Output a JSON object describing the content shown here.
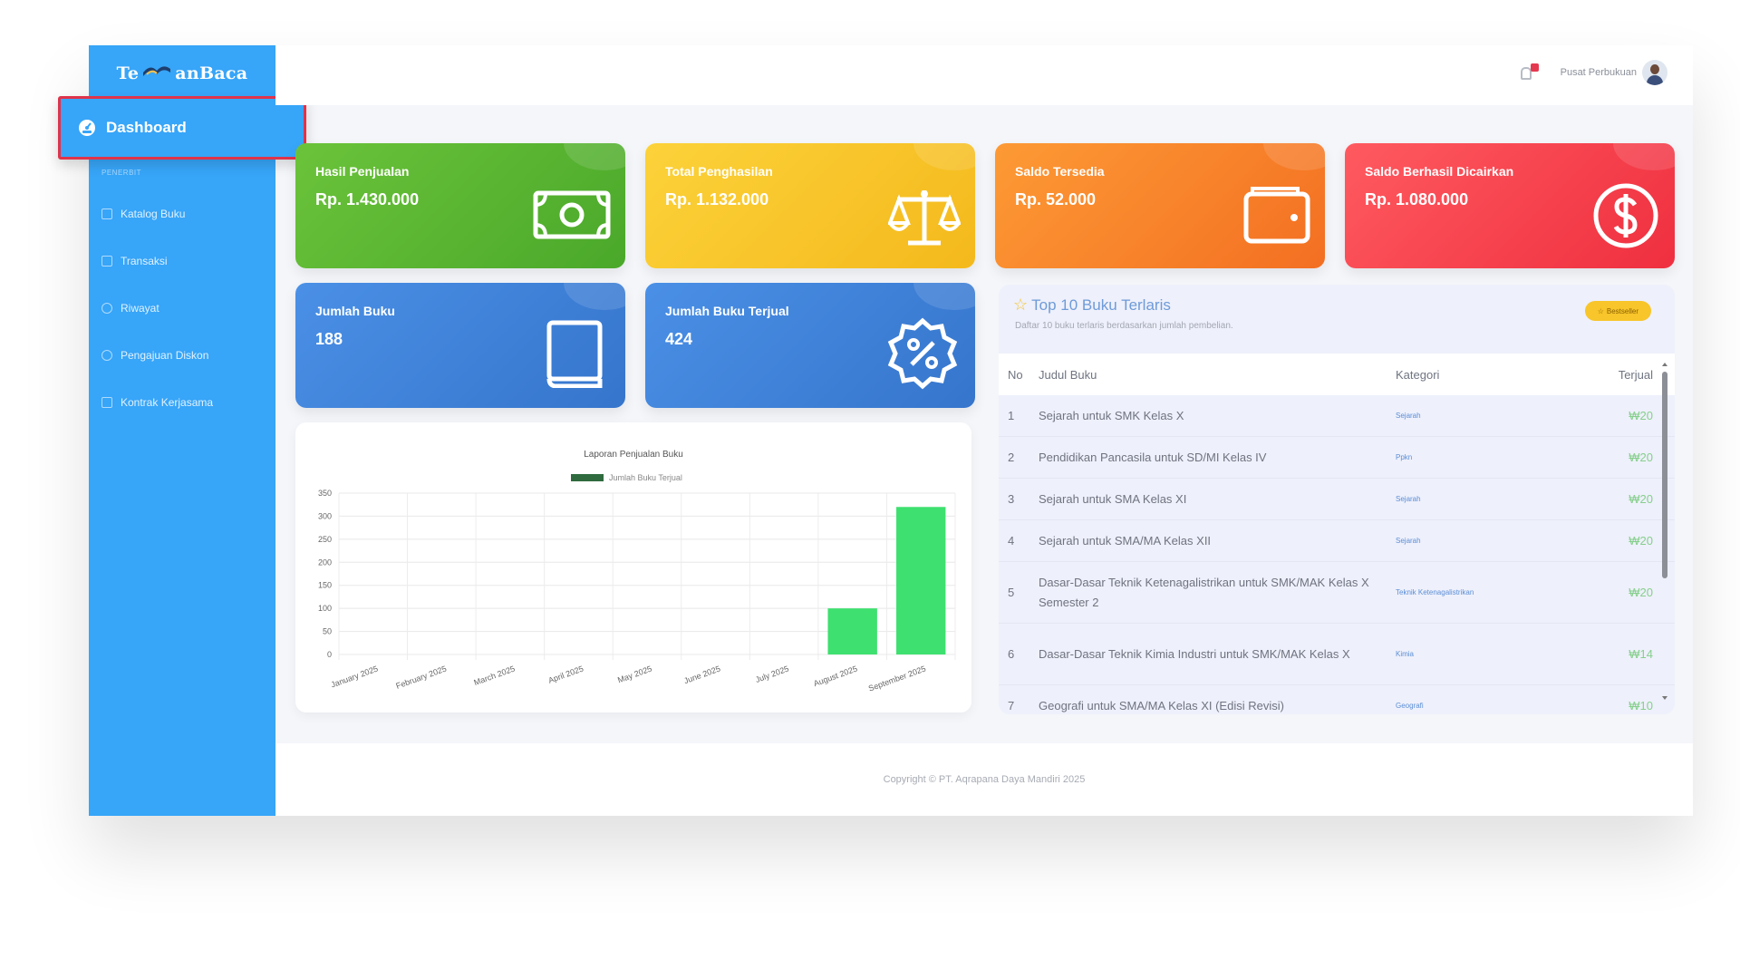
{
  "brand": {
    "left": "Te",
    "right": "anBaca"
  },
  "sidebar": {
    "active_item": "Dashboard",
    "section_label": "PENERBIT",
    "items": [
      {
        "label": "Katalog Buku",
        "icon": "book-icon"
      },
      {
        "label": "Transaksi",
        "icon": "cart-icon"
      },
      {
        "label": "Riwayat",
        "icon": "history-icon"
      },
      {
        "label": "Pengajuan Diskon",
        "icon": "percent-icon"
      },
      {
        "label": "Kontrak Kerjasama",
        "icon": "document-icon"
      }
    ]
  },
  "topbar": {
    "user_name": "Pusat Perbukuan"
  },
  "cards": {
    "hasil_penjualan": {
      "title": "Hasil Penjualan",
      "value": "Rp. 1.430.000",
      "icon": "money-icon"
    },
    "total_penghasilan": {
      "title": "Total Penghasilan",
      "value": "Rp. 1.132.000",
      "icon": "scale-icon"
    },
    "saldo_tersedia": {
      "title": "Saldo Tersedia",
      "value": "Rp. 52.000",
      "icon": "wallet-icon"
    },
    "saldo_dicairkan": {
      "title": "Saldo Berhasil Dicairkan",
      "value": "Rp. 1.080.000",
      "icon": "dollar-icon"
    },
    "jumlah_buku": {
      "title": "Jumlah Buku",
      "value": "188",
      "icon": "book-icon"
    },
    "jumlah_terjual": {
      "title": "Jumlah Buku Terjual",
      "value": "424",
      "icon": "discount-icon"
    }
  },
  "chart_data": {
    "type": "bar",
    "title": "Laporan Penjualan Buku",
    "categories": [
      "January 2025",
      "February 2025",
      "March 2025",
      "April 2025",
      "May 2025",
      "June 2025",
      "July 2025",
      "August 2025",
      "September 2025"
    ],
    "series": [
      {
        "name": "Jumlah Buku Terjual",
        "values": [
          0,
          0,
          0,
          0,
          0,
          0,
          0,
          100,
          320
        ]
      }
    ],
    "ylim": [
      0,
      350
    ],
    "yticks": [
      0,
      50,
      100,
      150,
      200,
      250,
      300,
      350
    ],
    "colors": {
      "bar": "#3ee06f",
      "legend": "#2f6b3e"
    },
    "grid": true,
    "legend": "top"
  },
  "top_books": {
    "title": "Top 10 Buku Terlaris",
    "subtitle": "Daftar 10 buku terlaris berdasarkan jumlah pembelian.",
    "badge": "Bestseller",
    "headers": {
      "no": "No",
      "title": "Judul Buku",
      "category": "Kategori",
      "sold": "Terjual"
    },
    "rows": [
      {
        "no": "1",
        "title": "Sejarah untuk SMK Kelas X",
        "category": "Sejarah",
        "sold": "20"
      },
      {
        "no": "2",
        "title": "Pendidikan Pancasila untuk SD/MI Kelas IV",
        "category": "Ppkn",
        "sold": "20"
      },
      {
        "no": "3",
        "title": "Sejarah untuk SMA Kelas XI",
        "category": "Sejarah",
        "sold": "20"
      },
      {
        "no": "4",
        "title": "Sejarah untuk SMA/MA Kelas XII",
        "category": "Sejarah",
        "sold": "20"
      },
      {
        "no": "5",
        "title": "Dasar-Dasar Teknik Ketenagalistrikan untuk SMK/MAK Kelas X Semester 2",
        "category": "Teknik Ketenagalistrikan",
        "sold": "20"
      },
      {
        "no": "6",
        "title": "Dasar-Dasar Teknik Kimia Industri untuk SMK/MAK Kelas X",
        "category": "Kimia",
        "sold": "14"
      },
      {
        "no": "7",
        "title": "Geografi untuk SMA/MA Kelas XI (Edisi Revisi)",
        "category": "Geografi",
        "sold": "10"
      }
    ]
  },
  "footer": {
    "text": "Copyright © PT. Aqrapana Daya Mandiri 2025"
  }
}
